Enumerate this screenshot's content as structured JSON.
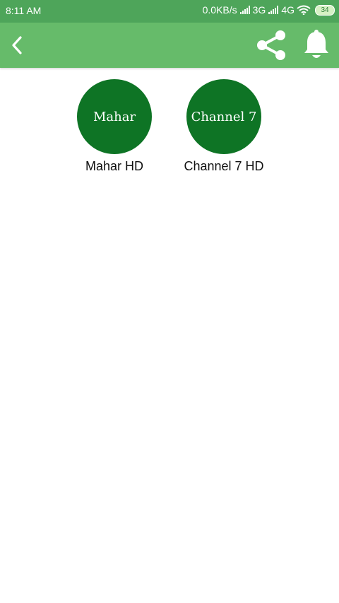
{
  "status_bar": {
    "time": "8:11 AM",
    "network_speed": "0.0KB/s",
    "network_1": "3G",
    "network_2": "4G",
    "battery": "34"
  },
  "app_bar": {
    "back_icon": "chevron-left-icon",
    "share_icon": "share-icon",
    "bell_icon": "bell-icon",
    "color": "#66bb6a"
  },
  "channels": [
    {
      "logo_text": "Mahar",
      "name": "Mahar HD"
    },
    {
      "logo_text": "Channel 7",
      "name": "Channel 7 HD"
    }
  ]
}
